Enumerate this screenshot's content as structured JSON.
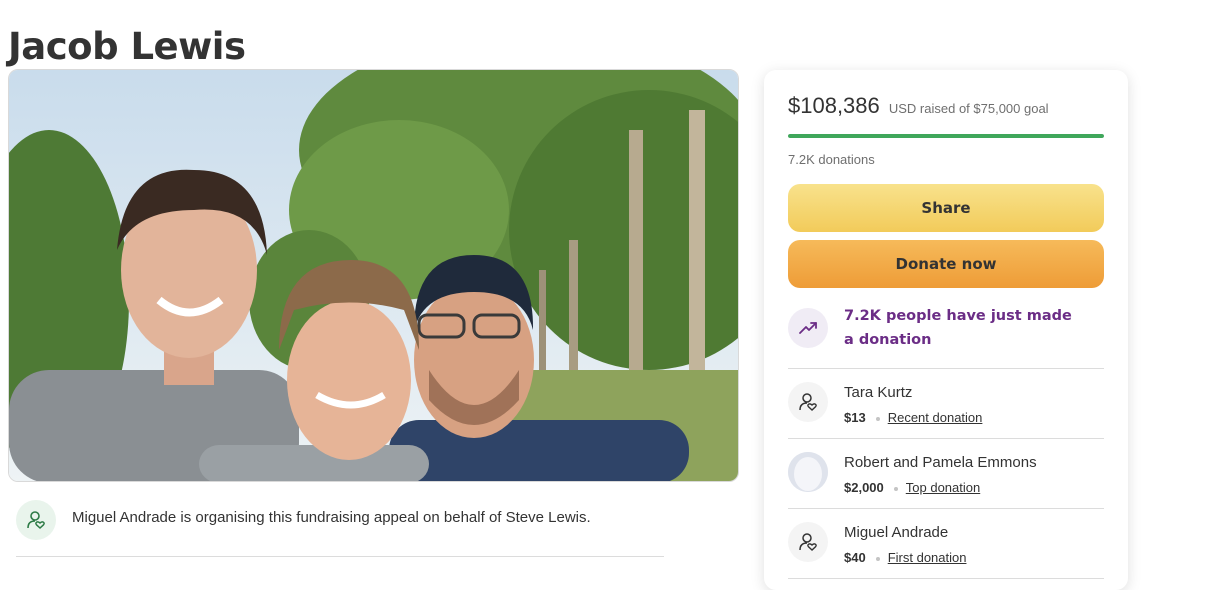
{
  "campaign": {
    "title": "Jacob Lewis",
    "organiser_text": "Miguel Andrade is organising this fundraising appeal on behalf of Steve Lewis."
  },
  "donation_card": {
    "amount_raised": "$108,386",
    "goal_text": "USD raised of $75,000 goal",
    "progress_fraction": 1.0,
    "donation_count": "7.2K donations",
    "share_label": "Share",
    "donate_label": "Donate now",
    "trend_text": "7.2K people have just made a donation",
    "donors": [
      {
        "name": "Tara Kurtz",
        "amount": "$13",
        "tag": "Recent donation",
        "icon": "donor-heart-icon"
      },
      {
        "name": "Robert and Pamela Emmons",
        "amount": "$2,000",
        "tag": "Top donation",
        "icon": "avatar-photo"
      },
      {
        "name": "Miguel Andrade",
        "amount": "$40",
        "tag": "First donation",
        "icon": "donor-heart-icon"
      }
    ]
  },
  "colors": {
    "progress": "#3fa75b",
    "share_button": "#f2cb5a",
    "donate_button": "#ee9c37",
    "trend_text": "#6b2d86",
    "organiser_icon": "#2c7a45"
  }
}
